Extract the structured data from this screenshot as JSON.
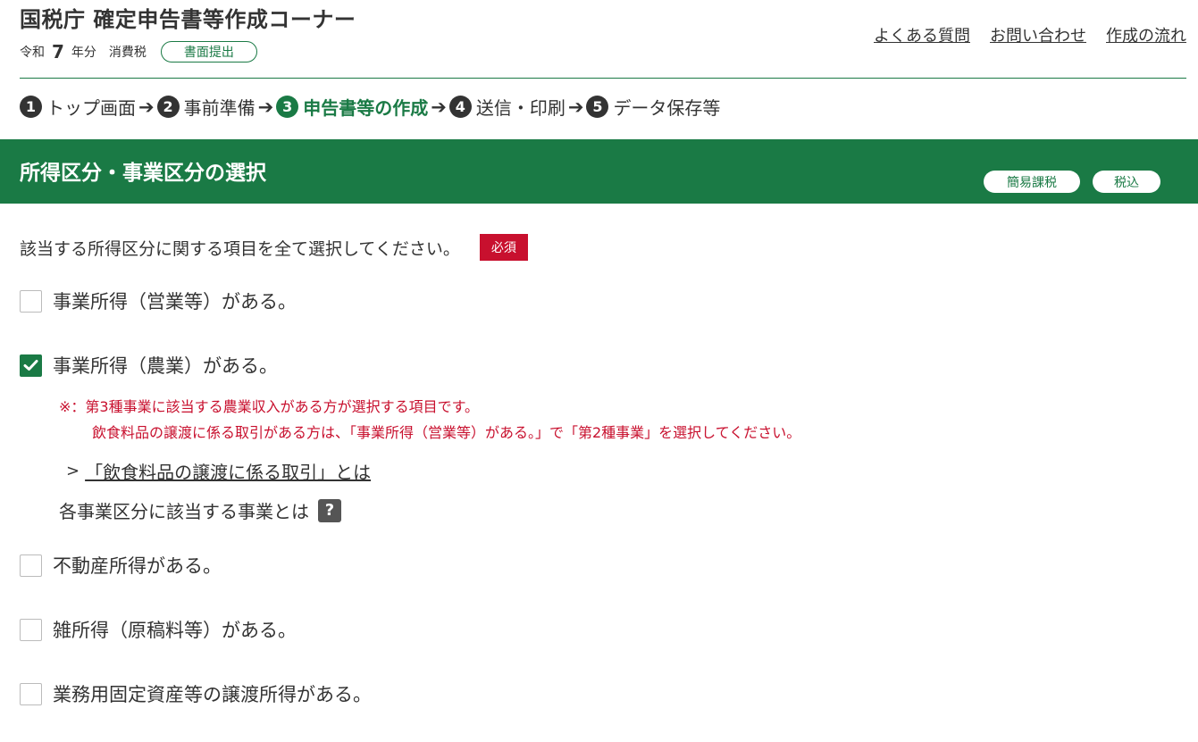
{
  "header": {
    "title": "国税庁 確定申告書等作成コーナー",
    "era": "令和",
    "year": "7",
    "year_suffix": "年分",
    "tax_type": "消費税",
    "submission_mode": "書面提出",
    "links": [
      "よくある質問",
      "お問い合わせ",
      "作成の流れ"
    ]
  },
  "steps": [
    {
      "num": "1",
      "label": "トップ画面"
    },
    {
      "num": "2",
      "label": "事前準備"
    },
    {
      "num": "3",
      "label": "申告書等の作成"
    },
    {
      "num": "4",
      "label": "送信・印刷"
    },
    {
      "num": "5",
      "label": "データ保存等"
    }
  ],
  "current_step": 3,
  "banner": {
    "title": "所得区分・事業区分の選択",
    "tags": [
      "簡易課税",
      "税込"
    ]
  },
  "form": {
    "question": "該当する所得区分に関する項目を全て選択してください。",
    "required_label": "必須",
    "options": [
      {
        "label": "事業所得（営業等）がある。",
        "checked": false
      },
      {
        "label": "事業所得（農業）がある。",
        "checked": true
      },
      {
        "label": "不動産所得がある。",
        "checked": false
      },
      {
        "label": "雑所得（原稿料等）がある。",
        "checked": false
      },
      {
        "label": "業務用固定資産等の譲渡所得がある。",
        "checked": false
      }
    ],
    "note_line1": "※：第3種事業に該当する農業収入がある方が選択する項目です。",
    "note_line2": "飲食料品の譲渡に係る取引がある方は、「事業所得（営業等）がある。」で「第2種事業」を選択してください。",
    "link_text": "「飲食料品の譲渡に係る取引」とは",
    "help_text": "各事業区分に該当する事業とは",
    "help_icon": "?"
  },
  "colors": {
    "brand_green": "#1a7a45",
    "required_red": "#c8102e",
    "text": "#333333"
  }
}
